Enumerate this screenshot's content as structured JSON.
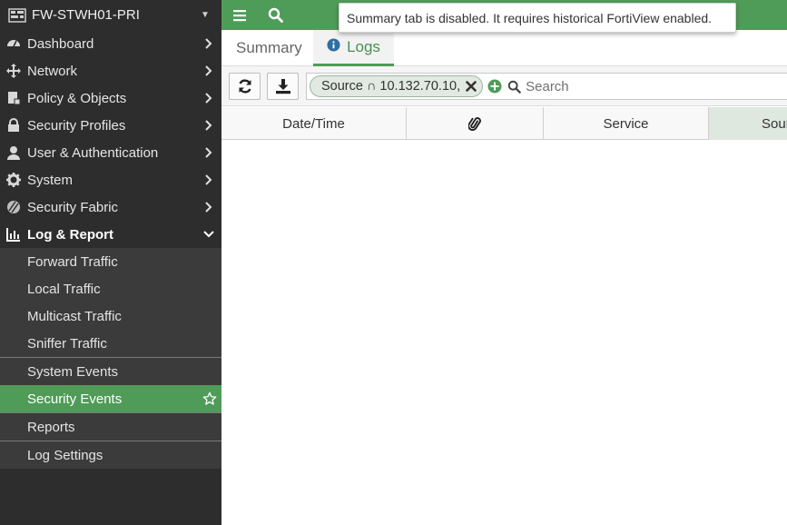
{
  "sidebar": {
    "device_name": "FW-STWH01-PRI",
    "items": [
      {
        "label": "Dashboard",
        "icon": "dashboard-icon"
      },
      {
        "label": "Network",
        "icon": "network-icon"
      },
      {
        "label": "Policy & Objects",
        "icon": "policy-icon"
      },
      {
        "label": "Security Profiles",
        "icon": "lock-icon"
      },
      {
        "label": "User & Authentication",
        "icon": "user-icon"
      },
      {
        "label": "System",
        "icon": "gear-icon"
      },
      {
        "label": "Security Fabric",
        "icon": "fabric-icon"
      },
      {
        "label": "Log & Report",
        "icon": "bar-chart-icon"
      }
    ],
    "log_report_items": [
      {
        "label": "Forward Traffic"
      },
      {
        "label": "Local Traffic"
      },
      {
        "label": "Multicast Traffic"
      },
      {
        "label": "Sniffer Traffic"
      },
      {
        "label": "System Events"
      },
      {
        "label": "Security Events"
      },
      {
        "label": "Reports"
      },
      {
        "label": "Log Settings"
      }
    ],
    "selected_item": "Security Events"
  },
  "tooltip": {
    "text": "Summary tab is disabled. It requires historical FortiView enabled."
  },
  "tabs": [
    {
      "label": "Summary"
    },
    {
      "label": "Logs"
    }
  ],
  "filter": {
    "chip_label": "Source ∩ 10.132.70.10,",
    "search_placeholder": "Search"
  },
  "table": {
    "columns": [
      "Date/Time",
      "",
      "Service",
      "Sour"
    ]
  },
  "colors": {
    "accent": "#4f9b58",
    "sidebar_bg": "#2d2d2d"
  }
}
